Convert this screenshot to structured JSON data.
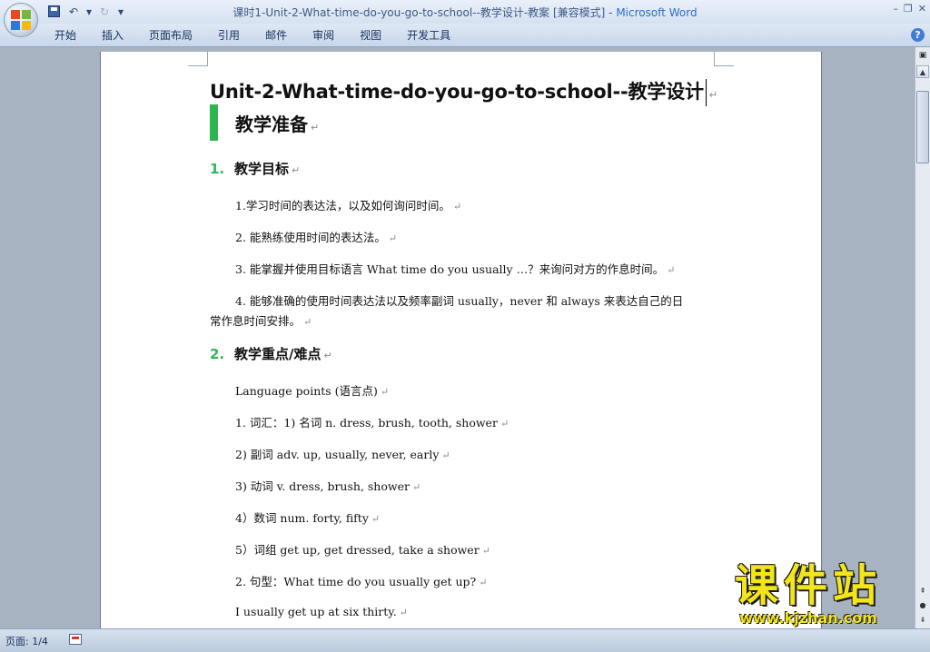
{
  "window": {
    "title": "课时1-Unit-2-What-time-do-you-go-to-school--教学设计-教案 [兼容模式] - ",
    "app_name": "Microsoft Word",
    "minimize": "–",
    "restore": "❐",
    "close": "✕"
  },
  "quick_access": {
    "undo": "↶",
    "undo_menu": "▾",
    "redo": "↻",
    "customize": "▾"
  },
  "ribbon": {
    "tabs": [
      "开始",
      "插入",
      "页面布局",
      "引用",
      "邮件",
      "审阅",
      "视图",
      "开发工具"
    ],
    "help": "?"
  },
  "document": {
    "title": "Unit-2-What-time-do-you-go-to-school--教学设计",
    "paragraph_mark": "↵",
    "section_heading": "教学准备",
    "objectives_heading": {
      "num": "1.",
      "text": "教学目标"
    },
    "objectives": [
      "1.学习时间的表达法，以及如何询问时间。",
      "2. 能熟练使用时间的表达法。",
      "3. 能掌握并使用目标语言 What time do you usually …？来询问对方的作息时间。",
      "4. 能够准确的使用时间表达法以及频率副词 usually，never 和 always 来表达自己的日",
      "常作息时间安排。"
    ],
    "keypoints_heading": {
      "num": "2.",
      "text": "教学重点/难点"
    },
    "keypoints": [
      "Language points (语言点)",
      "1. 词汇：1) 名词 n. dress, brush, tooth, shower",
      "2) 副词 adv. up, usually, never, early",
      "3) 动词 v. dress, brush, shower",
      "4）数词 num. forty, fifty",
      "5）词组 get up, get dressed, take a shower",
      "2. 句型：What time do you usually get up?",
      "I usually get up at six thirty."
    ]
  },
  "scrollbar": {
    "ruler_toggle": "▣",
    "up": "▲",
    "prev": "⇞",
    "browse": "●",
    "next": "⇟"
  },
  "status": {
    "page": "页面: 1/4"
  },
  "watermark": {
    "brand": "课件站",
    "url": "www.kjzhan.com"
  },
  "colors": {
    "accent_green": "#2eb553",
    "watermark_yellow": "#f2e51c",
    "app_blue": "#2a6fc4"
  }
}
